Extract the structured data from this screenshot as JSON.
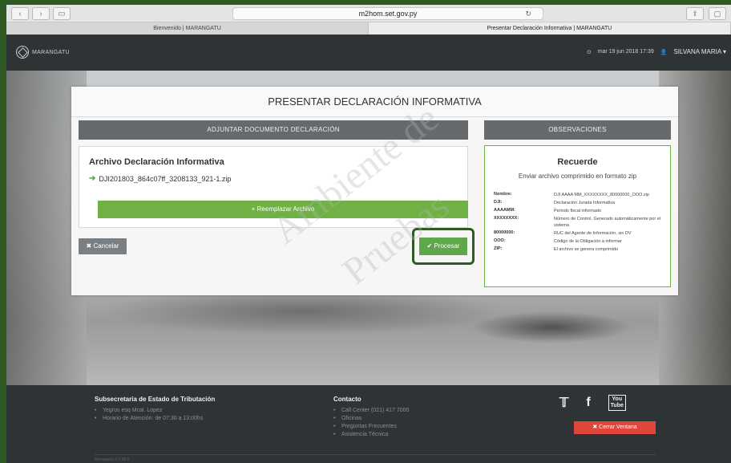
{
  "browser": {
    "url": "m2hom.set.gov.py",
    "tabs": [
      "Bienvenido | MARANGATU",
      "Presentar Declaración Informativa | MARANGATU"
    ]
  },
  "header": {
    "brand": "MARANGATU",
    "datetime": "mar 19 jun 2018 17:39",
    "user": "SILVANA MARIA"
  },
  "panel": {
    "title": "PRESENTAR DECLARACIÓN INFORMATIVA",
    "left_header": "ADJUNTAR DOCUMENTO DECLARACIÓN",
    "file_title": "Archivo Declaración Informativa",
    "file_name": "DJI201803_864c07ff_3208133_921-1.zip",
    "replace_label": "+ Reemplazar Archivo",
    "cancel_label": "✖ Cancelar",
    "process_label": "✔ Procesar",
    "right_header": "OBSERVACIONES",
    "rec_title": "Recuerde",
    "rec_sub": "Enviar archivo comprimido en formato zip",
    "obs": [
      {
        "k": "Nombre:",
        "v": "DJI AAAA MM_XXXXXXXX_80000000_OOO.zip"
      },
      {
        "k": "DJI:",
        "v": "Declaración Jurada Informativa"
      },
      {
        "k": "AAAAMM:",
        "v": "Periodo fiscal informado"
      },
      {
        "k": "XXXXXXXX:",
        "v": "Número de Control. Generado automáticamente por el sistema"
      },
      {
        "k": "80000000:",
        "v": "RUC del Agente de Información, sin DV"
      },
      {
        "k": "OOO:",
        "v": "Código de la Obligación a informar"
      },
      {
        "k": "ZIP:",
        "v": "El archivo se genera comprimido"
      }
    ],
    "watermark1": "Ambiente de",
    "watermark2": "Pruebas"
  },
  "footer": {
    "col1_title": "Subsecretaría de Estado de Tributación",
    "col1_items": [
      "Yegros esq Mcal. Lopez",
      "Horario de Atención: de 07:30 a 13:00hs"
    ],
    "col2_title": "Contacto",
    "col2_items": [
      "Call Center (021) 417 7000",
      "Oficinas",
      "Preguntas Frecuentes",
      "Asistencia Técnica"
    ],
    "close_label": "✖ Cerrar Ventana",
    "version": "Marangatu 2.0.38.0"
  }
}
